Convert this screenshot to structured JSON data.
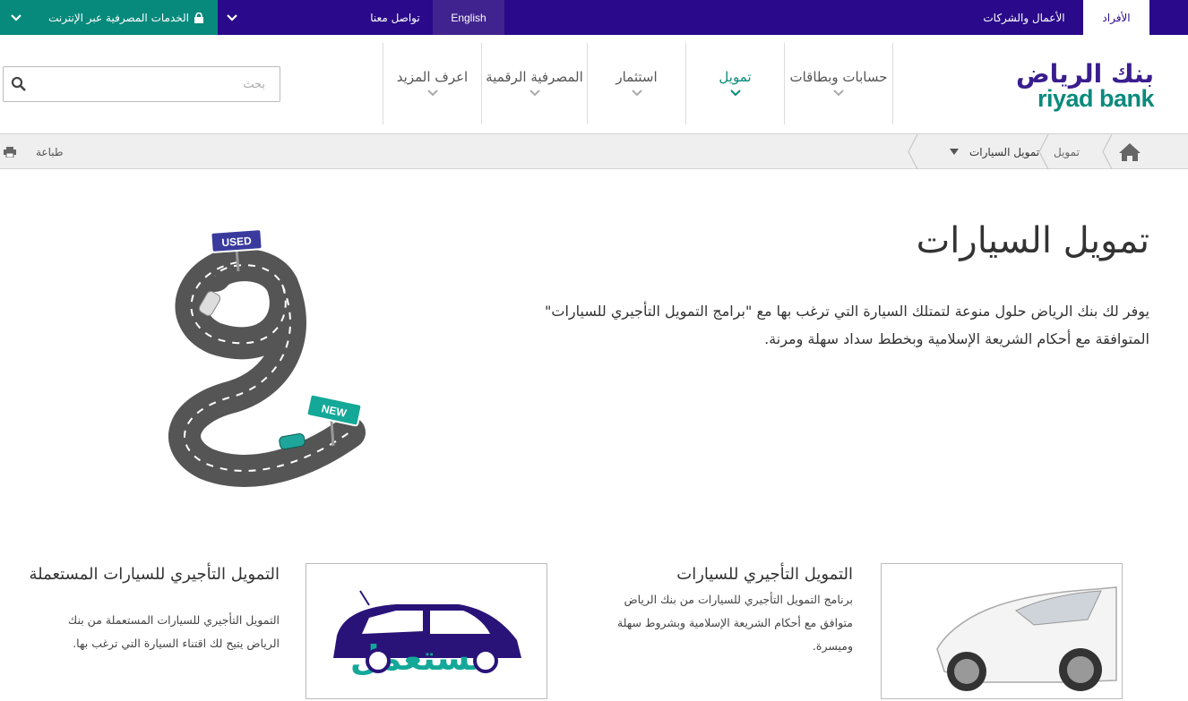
{
  "topbar": {
    "individuals": "الأفراد",
    "business": "الأعمال والشركات",
    "english": "English",
    "contact": "تواصل معنا",
    "online_banking": "الخدمات المصرفية عبر الإنترنت"
  },
  "logo": {
    "arabic": "بنك الرياض",
    "english": "riyad bank"
  },
  "nav": {
    "items": [
      {
        "label": "حسابات وبطاقات",
        "active": false
      },
      {
        "label": "تمويل",
        "active": true
      },
      {
        "label": "استثمار",
        "active": false
      },
      {
        "label": "المصرفية الرقمية",
        "active": false
      },
      {
        "label": "اعرف المزيد",
        "active": false
      }
    ]
  },
  "search": {
    "placeholder": "بحث"
  },
  "breadcrumb": {
    "items": [
      "تمويل",
      "تمويل السيارات"
    ],
    "print": "طباعة"
  },
  "hero": {
    "title": "تمويل السيارات",
    "description": "يوفر لك بنك الرياض حلول منوعة لتمتلك السيارة التي ترغب بها مع \"برامج التمويل التأجيري للسيارات\" المتوافقة مع أحكام الشريعة الإسلامية وبخطط سداد سهلة ومرنة.",
    "sign_used": "USED",
    "sign_new": "NEW"
  },
  "cards": [
    {
      "title": "التمويل التأجيري للسيارات",
      "description": "برنامج التمويل التأجيري للسيارات من بنك الرياض متوافق مع أحكام الشريعة الإسلامية وبشروط سهلة وميسرة."
    },
    {
      "title": "التمويل التأجيري للسيارات المستعملة",
      "description": "التمويل التأجيري للسيارات المستعملة من بنك الرياض يتيح لك اقتناء السيارة التي ترغب بها.",
      "image_text": "مستعمل"
    }
  ],
  "colors": {
    "brand_purple": "#2a0a8a",
    "brand_teal": "#078a7c"
  }
}
